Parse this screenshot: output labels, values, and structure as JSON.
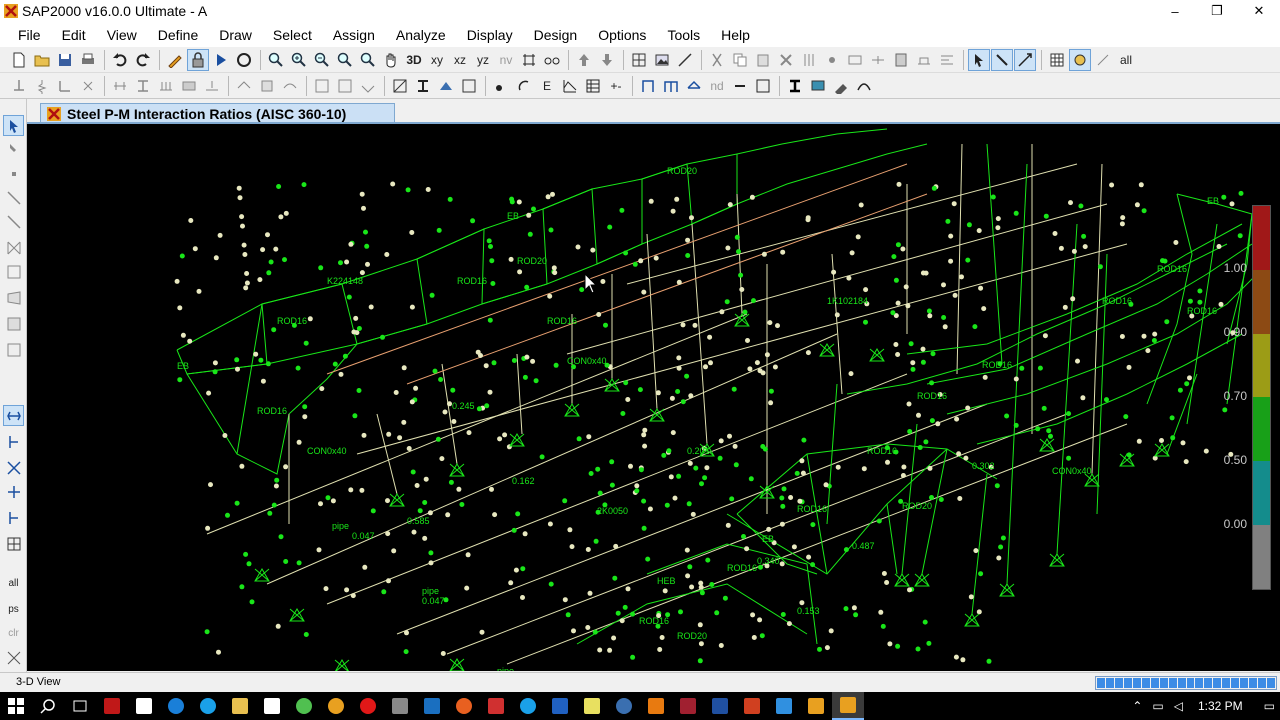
{
  "window": {
    "title": "SAP2000 v16.0.0 Ultimate  - A",
    "minimize": "–",
    "restore": "❐",
    "close": "✕"
  },
  "menu": [
    "File",
    "Edit",
    "View",
    "Define",
    "Draw",
    "Select",
    "Assign",
    "Analyze",
    "Display",
    "Design",
    "Options",
    "Tools",
    "Help"
  ],
  "toolbar1": {
    "xy_label": "xy",
    "xz_label": "xz",
    "yz_label": "yz",
    "nv_label": "nv"
  },
  "toolbar2": {
    "nd_label": "nd"
  },
  "document_tab": {
    "title": "Steel P-M Interaction Ratios  (AISC 360-10)"
  },
  "legend": {
    "labels": [
      "1.00",
      "0.90",
      "0.70",
      "0.50",
      "0.00"
    ],
    "colors": [
      "#a01818",
      "#8c4a14",
      "#9c9c16",
      "#18a018",
      "#148c8c",
      "#808080"
    ]
  },
  "viewport_labels": {
    "section_labels": [
      "ROD16",
      "ROD20",
      "EB",
      "K224148",
      "pipe",
      "CON0x40",
      "2K0050",
      "HEB",
      "1K102184"
    ],
    "ratio_labels": [
      "0.047",
      "0.040",
      "0.302",
      "0.201",
      "0.245",
      "0.162",
      "0.585",
      "0.487",
      "0.340",
      "0.153"
    ]
  },
  "status": {
    "view": "3-D View"
  },
  "taskbar": {
    "time": "1:32 PM"
  },
  "colors": {
    "member_green": "#19e619",
    "viewport_bg": "#000000",
    "tab_bg": "#cbe0f5",
    "progress": "#3c8ce6"
  }
}
